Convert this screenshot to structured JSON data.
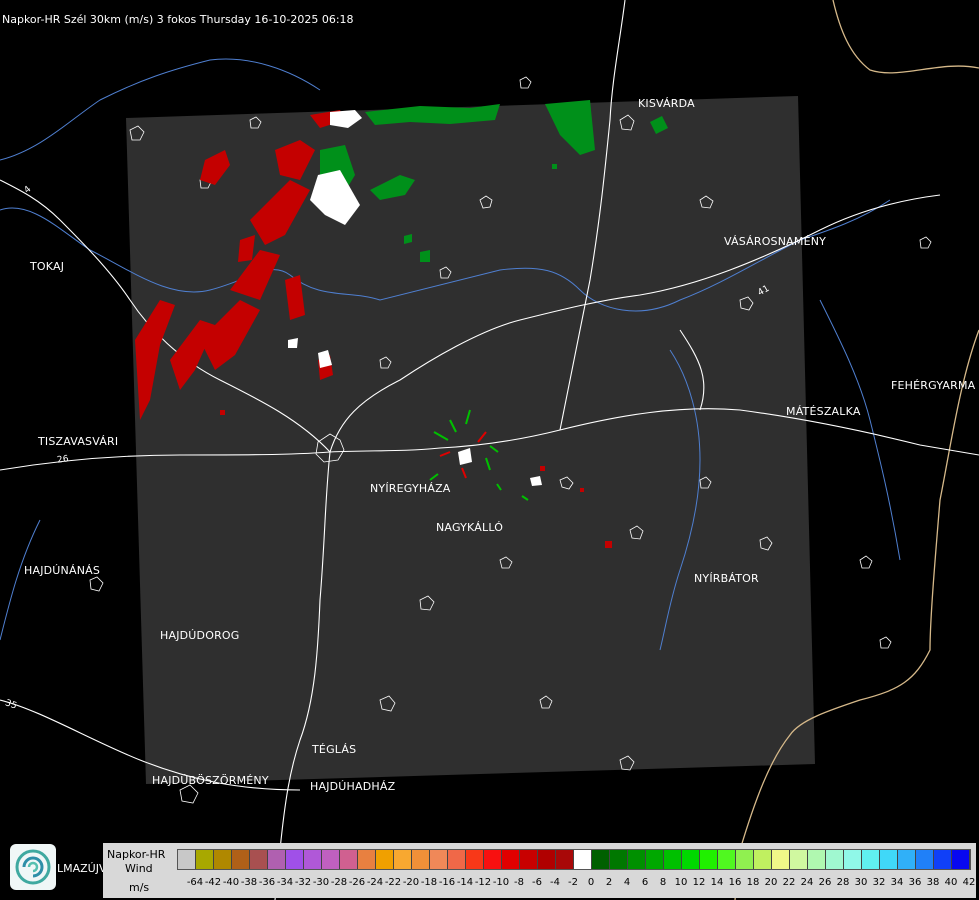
{
  "header": {
    "title": "Napkor-HR Szél 30km (m/s) 3 fokos Thursday 16-10-2025 06:18"
  },
  "cities": [
    {
      "id": "kisvarda",
      "label": "KISVÁRDA"
    },
    {
      "id": "tokaj",
      "label": "TOKAJ"
    },
    {
      "id": "vasarosnameny",
      "label": "VÁSÁROSNAMÉNY"
    },
    {
      "id": "fehergyarmat",
      "label": "FEHÉRGYARMA"
    },
    {
      "id": "mateszalka",
      "label": "MÁTÉSZALKA"
    },
    {
      "id": "tiszavasvari",
      "label": "TISZAVASVÁRI"
    },
    {
      "id": "nyiregyhaza",
      "label": "NYÍREGYHÁZA"
    },
    {
      "id": "nagykallo",
      "label": "NAGYKÁLLÓ"
    },
    {
      "id": "hajdunanas",
      "label": "HAJDÚNÁNÁS"
    },
    {
      "id": "nyirbator",
      "label": "NYÍRBÁTOR"
    },
    {
      "id": "hajdudorog",
      "label": "HAJDÚDOROG"
    },
    {
      "id": "teglas",
      "label": "TÉGLÁS"
    },
    {
      "id": "hajduboszormeny",
      "label": "HAJDÚBÖSZÖRMÉNY"
    },
    {
      "id": "hajduhadhaz",
      "label": "HAJDÚHADHÁZ"
    }
  ],
  "road_labels": [
    "26",
    "41",
    "35",
    "4"
  ],
  "legend": {
    "line1": "Napkor-HR",
    "line2": "Wind",
    "line3": "m/s",
    "tick_labels": [
      "-64",
      "-42",
      "-40",
      "-38",
      "-36",
      "-34",
      "-32",
      "-30",
      "-28",
      "-26",
      "-24",
      "-22",
      "-20",
      "-18",
      "-16",
      "-14",
      "-12",
      "-10",
      "-8",
      "-6",
      "-4",
      "-2",
      "0",
      "2",
      "4",
      "6",
      "8",
      "10",
      "12",
      "14",
      "16",
      "18",
      "20",
      "22",
      "24",
      "26",
      "28",
      "30",
      "32",
      "34",
      "36",
      "38",
      "40",
      "42"
    ],
    "colors": [
      "#c8c8c8",
      "#a8a800",
      "#b08800",
      "#b06018",
      "#a85050",
      "#b060b0",
      "#a050e8",
      "#b058d8",
      "#c060c0",
      "#d06090",
      "#e88040",
      "#f0a000",
      "#f8a830",
      "#f09038",
      "#f08858",
      "#f06848",
      "#f83818",
      "#f81010",
      "#e00000",
      "#c80000",
      "#b00000",
      "#a80808",
      "#ffffff",
      "#006000",
      "#007800",
      "#009000",
      "#00a800",
      "#00c000",
      "#00d800",
      "#20f000",
      "#50f820",
      "#90f050",
      "#c0f060",
      "#f0f888",
      "#d0f8a0",
      "#b0f8b0",
      "#a0f8d0",
      "#90f8e8",
      "#60f0f0",
      "#40d8f8",
      "#30b0f8",
      "#2080f8",
      "#1040f8",
      "#0808f0"
    ]
  },
  "branding": {
    "logo_text": "LMAZÚJVÁR"
  }
}
